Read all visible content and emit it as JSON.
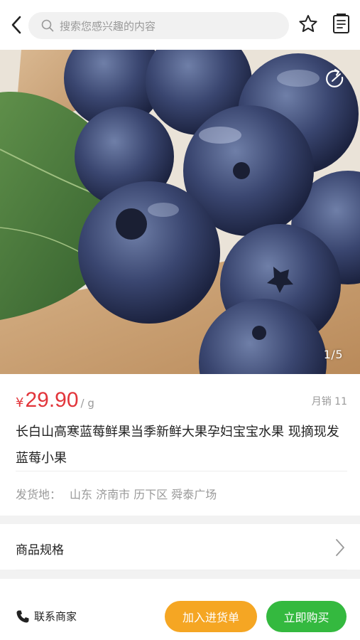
{
  "header": {
    "search_placeholder": "搜索您感兴趣的内容",
    "icons": [
      "back-icon",
      "search-icon",
      "star-icon",
      "notes-icon"
    ]
  },
  "gallery": {
    "counter": "1/5",
    "icons": [
      "share-icon"
    ]
  },
  "product": {
    "currency": "¥",
    "price": "29.90",
    "unit": "/ g",
    "sales": "月销 11",
    "title": "长白山高寒蓝莓鲜果当季新鲜大果孕妇宝宝水果 现摘现发 蓝莓小果",
    "ship_label": "发货地：",
    "ship_location": "山东 济南市 历下区 舜泰广场"
  },
  "spec": {
    "label": "商品规格"
  },
  "bottom_bar": {
    "contact_label": "联系商家",
    "add_cart_label": "加入进货单",
    "buy_label": "立即购买"
  },
  "colors": {
    "price": "#e2353b",
    "cart_button": "#f5a623",
    "buy_button": "#34b93f"
  }
}
